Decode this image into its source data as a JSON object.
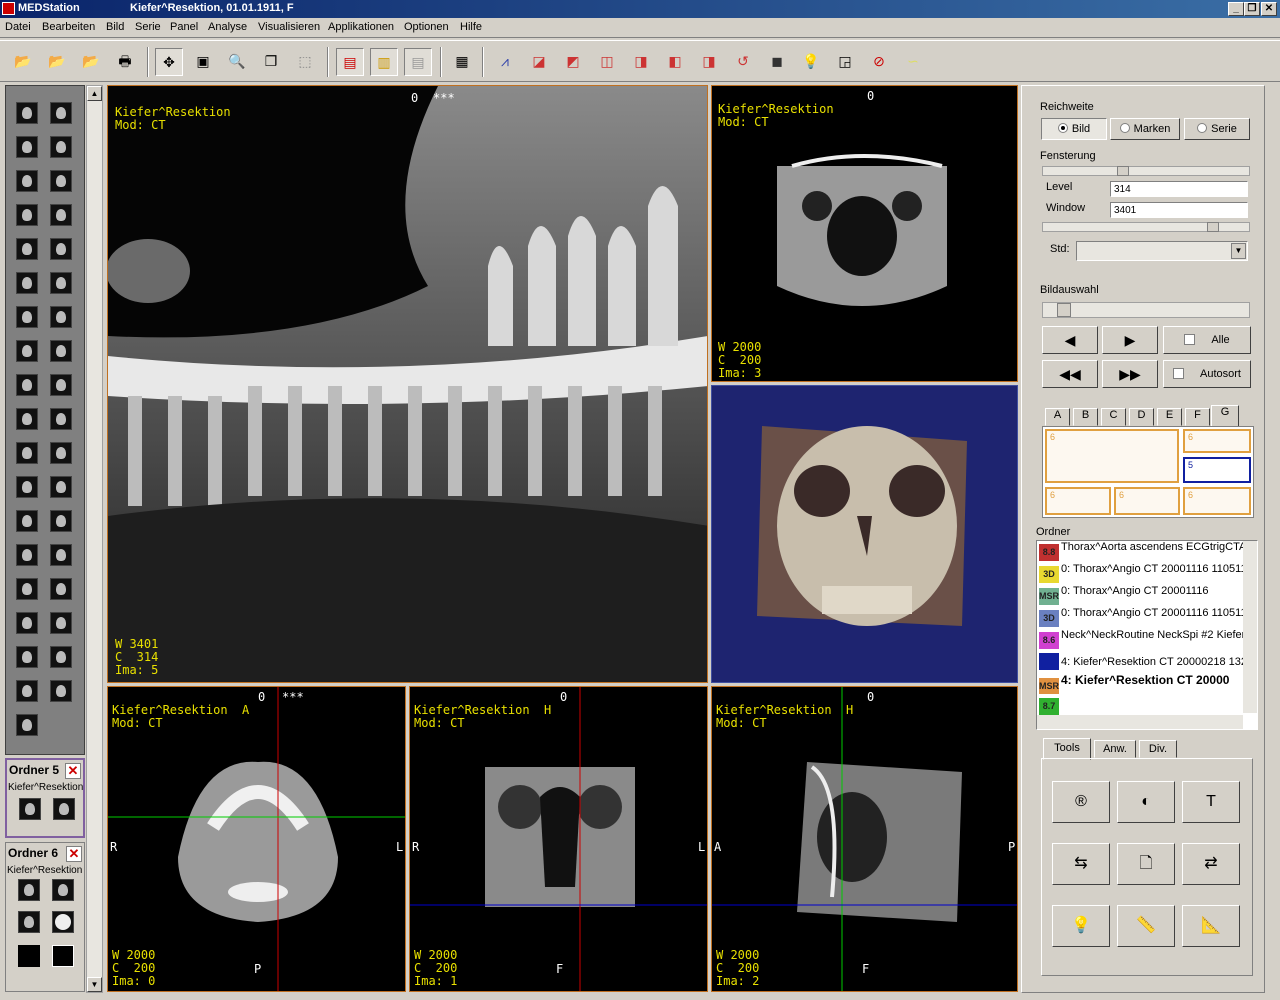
{
  "window": {
    "app_name": "MEDStation",
    "document_title": "Kiefer^Resektion, 01.01.1911, F",
    "minimize": "_",
    "restore": "❐",
    "close": "✕"
  },
  "menu": [
    "Datei",
    "Bearbeiten",
    "Bild",
    "Serie",
    "Panel",
    "Analyse",
    "Visualisieren",
    "Applikationen",
    "Optionen",
    "Hilfe"
  ],
  "left_folders": [
    {
      "title": "Ordner 5",
      "subtitle": "Kiefer^Resektion"
    },
    {
      "title": "Ordner 6",
      "subtitle": "Kiefer^Resektion"
    }
  ],
  "viewports": {
    "main": {
      "header": "Kiefer^Resektion\nMod: CT",
      "index": "0",
      "marker": "***",
      "footer": "W 3401\nC  314\nIma: 5"
    },
    "coronal_top": {
      "header": "Kiefer^Resektion\nMod: CT",
      "index": "0",
      "footer": "W 2000\nC  200\nIma: 3"
    },
    "axial": {
      "header": "Kiefer^Resektion  A\nMod: CT",
      "index": "0",
      "marker": "***",
      "left": "R",
      "right": "L",
      "bottom": "P",
      "footer": "W 2000\nC  200\nIma: 0"
    },
    "coronal": {
      "header": "Kiefer^Resektion  H\nMod: CT",
      "index": "0",
      "left": "R",
      "right": "L",
      "bottom": "F",
      "footer": "W 2000\nC  200\nIma: 1"
    },
    "sagittal": {
      "header": "Kiefer^Resektion  H\nMod: CT",
      "index": "0",
      "left": "A",
      "right": "P",
      "bottom": "F",
      "footer": "W 2000\nC  200\nIma: 2"
    }
  },
  "panel": {
    "reichweite": {
      "label": "Reichweite",
      "options": [
        "Bild",
        "Marken",
        "Serie"
      ],
      "selected": "Bild"
    },
    "fensterung": {
      "label": "Fensterung",
      "level_label": "Level",
      "level": "314",
      "window_label": "Window",
      "window": "3401",
      "std_label": "Std:"
    },
    "bildauswahl": {
      "label": "Bildauswahl",
      "alle": "Alle",
      "autosort": "Autosort"
    },
    "tabs": [
      "A",
      "B",
      "C",
      "D",
      "E",
      "F",
      "G"
    ],
    "grid_cells": [
      "6",
      "6",
      "5",
      "6",
      "6",
      "6"
    ],
    "ordner_label": "Ordner",
    "ordner_items": [
      {
        "badge": "8.8",
        "color": "#c03030",
        "text": "Thorax^Aorta ascendens ECGtrigCTA"
      },
      {
        "badge": "3D",
        "color": "#e8d830",
        "text": "0: Thorax^Angio CT 20001116 110511"
      },
      {
        "badge": "MSR",
        "color": "#70b090",
        "text": "0: Thorax^Angio CT 20001116"
      },
      {
        "badge": "3D",
        "color": "#6a80c0",
        "text": "0: Thorax^Angio CT 20001116 110511"
      },
      {
        "badge": "8.6",
        "color": "#d040d0",
        "text": "Neck^NeckRoutine NeckSpi #2 Kiefer^"
      },
      {
        "badge": "",
        "color": "#1020a0",
        "text": "4: Kiefer^Resektion CT 20000218 132"
      },
      {
        "badge": "MSR",
        "color": "#e09040",
        "text": "4: Kiefer^Resektion CT 20000"
      },
      {
        "badge": "8.7",
        "color": "#30b030",
        "text": ""
      }
    ],
    "tool_tabs": [
      "Tools",
      "Anw.",
      "Div."
    ]
  }
}
